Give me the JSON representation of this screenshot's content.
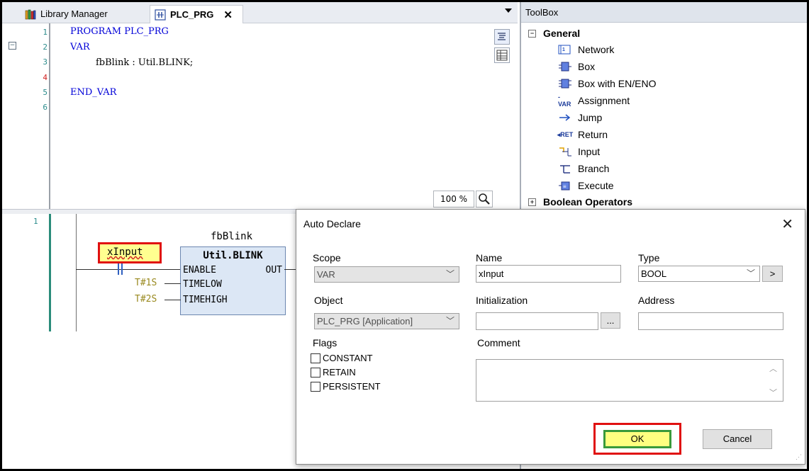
{
  "tabs": [
    {
      "label": "Library Manager",
      "active": false
    },
    {
      "label": "PLC_PRG",
      "active": true
    }
  ],
  "declaration": {
    "line_numbers": [
      "1",
      "2",
      "3",
      "4",
      "5",
      "6"
    ],
    "lines": [
      "PROGRAM PLC_PRG",
      "VAR",
      "fbBlink : Util.BLINK;",
      "",
      "END_VAR",
      ""
    ],
    "zoom": "100 %"
  },
  "body": {
    "network_number": "1",
    "fb_instance": "fbBlink",
    "fb_type": "Util.BLINK",
    "inputs": [
      "ENABLE",
      "TIMELOW",
      "TIMEHIGH"
    ],
    "output": "OUT",
    "literals": [
      "T#1S",
      "T#2S"
    ],
    "input_var": "xInput"
  },
  "toolbox": {
    "title": "ToolBox",
    "categories": [
      {
        "label": "General",
        "expanded": true
      },
      {
        "label": "Boolean Operators",
        "expanded": false
      }
    ],
    "items": [
      {
        "label": "Network",
        "icon": "network-icon"
      },
      {
        "label": "Box",
        "icon": "box-icon"
      },
      {
        "label": "Box with EN/ENO",
        "icon": "box-en-eno-icon"
      },
      {
        "label": "Assignment",
        "icon": "assignment-icon"
      },
      {
        "label": "Jump",
        "icon": "jump-icon"
      },
      {
        "label": "Return",
        "icon": "return-icon"
      },
      {
        "label": "Input",
        "icon": "input-icon"
      },
      {
        "label": "Branch",
        "icon": "branch-icon"
      },
      {
        "label": "Execute",
        "icon": "execute-icon"
      }
    ]
  },
  "dialog": {
    "title": "Auto Declare",
    "scope_label": "Scope",
    "scope_value": "VAR",
    "name_label": "Name",
    "name_value": "xInput",
    "type_label": "Type",
    "type_value": "BOOL",
    "type_btn": ">",
    "object_label": "Object",
    "object_value": "PLC_PRG [Application]",
    "init_label": "Initialization",
    "init_value": "",
    "init_btn": "...",
    "address_label": "Address",
    "address_value": "",
    "flags_label": "Flags",
    "flags": [
      "CONSTANT",
      "RETAIN",
      "PERSISTENT"
    ],
    "comment_label": "Comment",
    "ok": "OK",
    "cancel": "Cancel"
  }
}
